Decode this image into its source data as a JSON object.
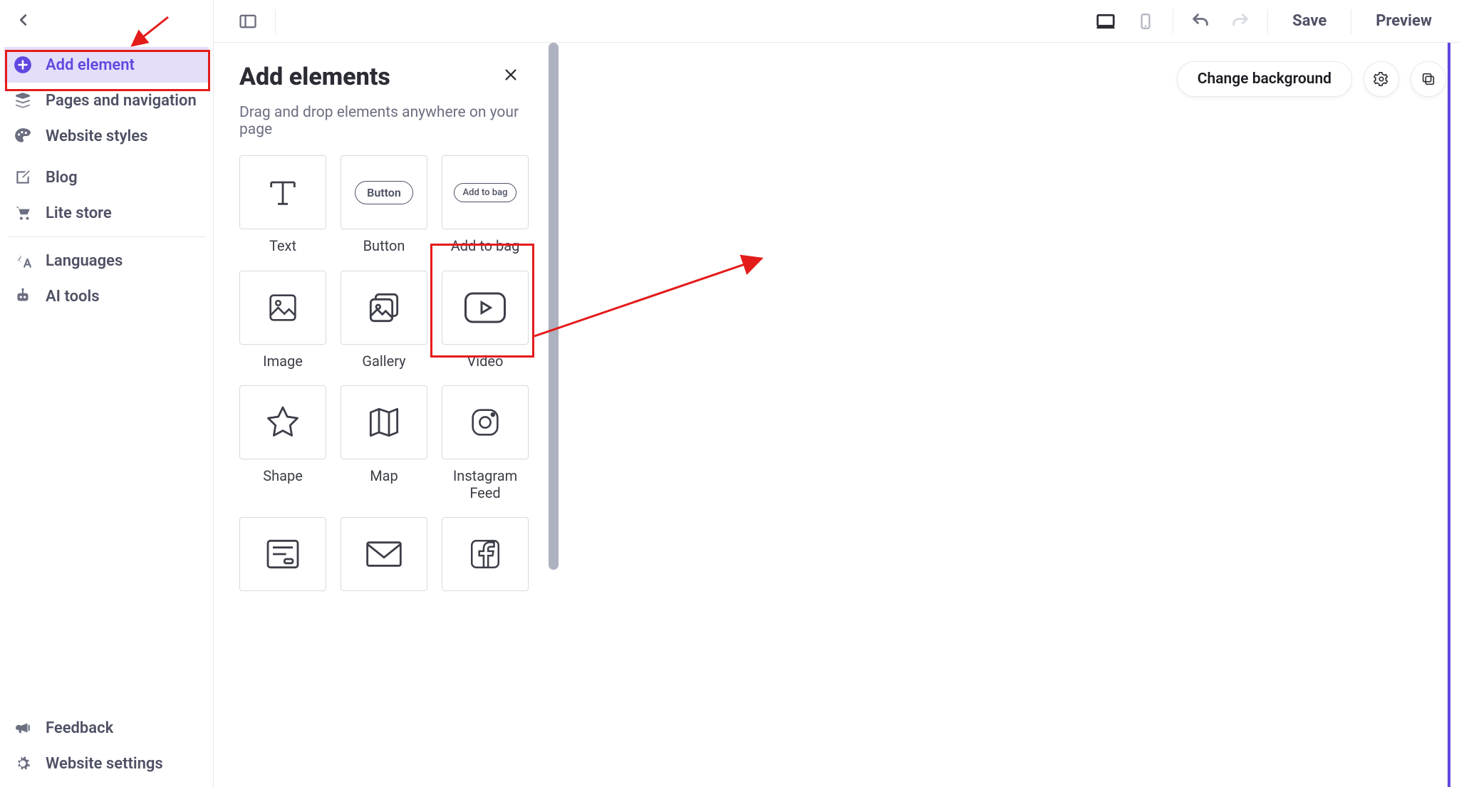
{
  "sidebar": {
    "items": [
      {
        "label": "Add element"
      },
      {
        "label": "Pages and navigation"
      },
      {
        "label": "Website styles"
      },
      {
        "label": "Blog"
      },
      {
        "label": "Lite store"
      },
      {
        "label": "Languages"
      },
      {
        "label": "AI tools"
      }
    ],
    "bottom": [
      {
        "label": "Feedback"
      },
      {
        "label": "Website settings"
      }
    ]
  },
  "topbar": {
    "save": "Save",
    "preview": "Preview"
  },
  "panel": {
    "title": "Add elements",
    "subtitle": "Drag and drop elements anywhere on your page",
    "elements": [
      {
        "label": "Text"
      },
      {
        "label": "Button",
        "pill": "Button"
      },
      {
        "label": "Add to bag",
        "pill": "Add to bag"
      },
      {
        "label": "Image"
      },
      {
        "label": "Gallery"
      },
      {
        "label": "Video"
      },
      {
        "label": "Shape"
      },
      {
        "label": "Map"
      },
      {
        "label": "Instagram Feed"
      },
      {
        "label": ""
      },
      {
        "label": ""
      },
      {
        "label": ""
      }
    ]
  },
  "canvas": {
    "change_bg": "Change background"
  }
}
